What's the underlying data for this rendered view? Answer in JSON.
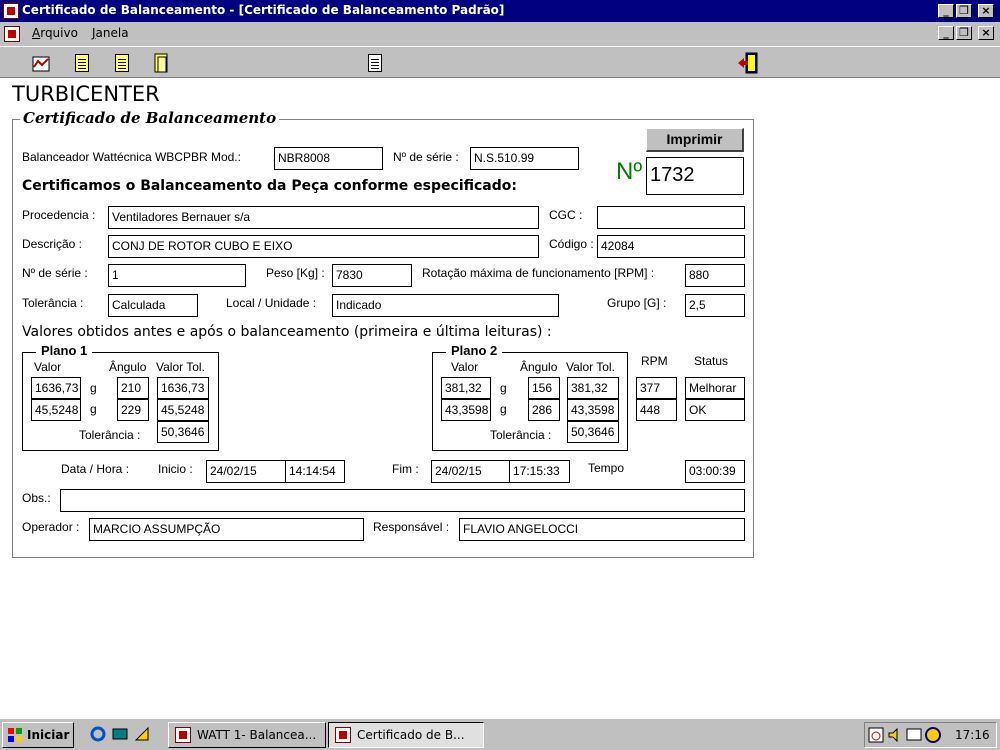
{
  "window": {
    "title": "Certificado de Balanceamento - [Certificado de Balanceamento Padrão]",
    "minimize": "_",
    "restore": "❐",
    "close": "×"
  },
  "menu": {
    "items": [
      {
        "accel": "A",
        "rest": "rquivo"
      },
      {
        "accel": "J",
        "rest": "anela"
      }
    ]
  },
  "header": {
    "company": "TURBICENTER",
    "section_title": "Certificado de Balanceamento",
    "print_label": "Imprimir",
    "number_label": "Nº",
    "number_value": "1732"
  },
  "machine": {
    "balancer_label": "Balanceador Wattécnica WBCPBR Mod.:",
    "model": "NBR8008",
    "serial_label": "Nº de série :",
    "serial": "N.S.510.99"
  },
  "statement": "Certificamos o Balanceamento da Peça conforme especificado:",
  "part": {
    "origin_label": "Procedencia :",
    "origin": "Ventiladores Bernauer s/a",
    "cgc_label": "CGC :",
    "cgc": "",
    "description_label": "Descrição :",
    "description": "CONJ DE ROTOR CUBO E EIXO",
    "code_label": "Código :",
    "code": "42084",
    "serial_label": "Nº de série :",
    "serial": "1",
    "weight_label": "Peso [Kg] :",
    "weight": "7830",
    "rpm_max_label": "Rotação máxima de funcionamento [RPM] :",
    "rpm_max": "880",
    "tolerance_label": "Tolerância :",
    "tolerance": "Calculada",
    "location_label": "Local / Unidade :",
    "location": "Indicado",
    "group_label": "Grupo [G] :",
    "group": "2,5"
  },
  "values_heading": "Valores obtidos antes e após o balanceamento (primeira e última leituras) :",
  "plane1": {
    "title": "Plano 1",
    "col_value": "Valor",
    "col_angle": "Ângulo",
    "col_tol": "Valor Tol.",
    "unit": "g",
    "rows": [
      {
        "value": "1636,73",
        "angle": "210",
        "tol": "1636,73"
      },
      {
        "value": "45,5248",
        "angle": "229",
        "tol": "45,5248"
      }
    ],
    "tolerance_label": "Tolerância :",
    "tolerance": "50,3646"
  },
  "plane2": {
    "title": "Plano 2",
    "col_value": "Valor",
    "col_angle": "Ângulo",
    "col_tol": "Valor Tol.",
    "unit": "g",
    "rows": [
      {
        "value": "381,32",
        "angle": "156",
        "tol": "381,32"
      },
      {
        "value": "43,3598",
        "angle": "286",
        "tol": "43,3598"
      }
    ],
    "tolerance_label": "Tolerância :",
    "tolerance": "50,3646"
  },
  "rpm_col": {
    "label": "RPM",
    "rows": [
      "377",
      "448"
    ]
  },
  "status_col": {
    "label": "Status",
    "rows": [
      "Melhorar",
      "OK"
    ]
  },
  "timing": {
    "datetime_label": "Data / Hora :",
    "start_label": "Inicio :",
    "start_date": "24/02/15",
    "start_time": "14:14:54",
    "end_label": "Fim :",
    "end_date": "24/02/15",
    "end_time": "17:15:33",
    "duration_label": "Tempo",
    "duration": "03:00:39"
  },
  "obs": {
    "label": "Obs.:",
    "value": ""
  },
  "people": {
    "operator_label": "Operador :",
    "operator": "MARCIO ASSUMPÇÃO",
    "responsible_label": "Responsável :",
    "responsible": "FLAVIO ANGELOCCI"
  },
  "taskbar": {
    "start_label": "Iniciar",
    "tasks": [
      "WATT 1- Balancea...",
      "Certificado de B..."
    ],
    "clock": "17:16"
  },
  "colors": {
    "titlebar": "#000080",
    "face": "#c0c0c0",
    "number_green": "#008000"
  }
}
